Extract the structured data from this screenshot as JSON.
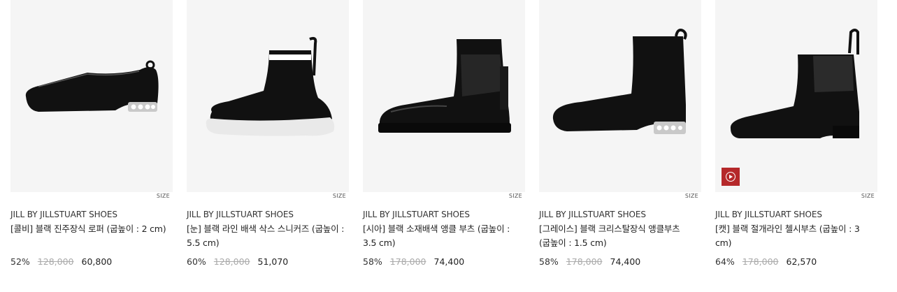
{
  "products": [
    {
      "brand": "JILL BY JILLSTUART SHOES",
      "name": "[콜비] 블랙 진주장식 로퍼 (굽높이 : 2 cm)",
      "discount": "52%",
      "original_price": "128,000",
      "sale_price": "60,800",
      "size_label": "SIZE",
      "icon": "loafer"
    },
    {
      "brand": "JILL BY JILLSTUART SHOES",
      "name": "[눈] 블랙 라인 배색 삭스 스니커즈 (굽높이 : 5.5 cm)",
      "discount": "60%",
      "original_price": "128,000",
      "sale_price": "51,070",
      "size_label": "SIZE",
      "icon": "sock-sneaker"
    },
    {
      "brand": "JILL BY JILLSTUART SHOES",
      "name": "[시아] 블랙 소재배색 앵클 부츠 (굽높이 : 3.5 cm)",
      "discount": "58%",
      "original_price": "178,000",
      "sale_price": "74,400",
      "size_label": "SIZE",
      "icon": "ankle-boot"
    },
    {
      "brand": "JILL BY JILLSTUART SHOES",
      "name": "[그레이스] 블랙 크리스탈장식 앵클부츠 (굽높이 : 1.5 cm)",
      "discount": "58%",
      "original_price": "178,000",
      "sale_price": "74,400",
      "size_label": "SIZE",
      "icon": "crystal-ankle-boot"
    },
    {
      "brand": "JILL BY JILLSTUART SHOES",
      "name": "[캣] 블랙 절개라인 첼시부츠 (굽높이 : 3 cm)",
      "discount": "64%",
      "original_price": "178,000",
      "sale_price": "62,570",
      "size_label": "SIZE",
      "icon": "chelsea-boot",
      "has_video": true
    }
  ],
  "colors": {
    "video_badge": "#b5282a",
    "thumb_bg": "#f5f5f5",
    "strike": "#aaaaaa"
  }
}
